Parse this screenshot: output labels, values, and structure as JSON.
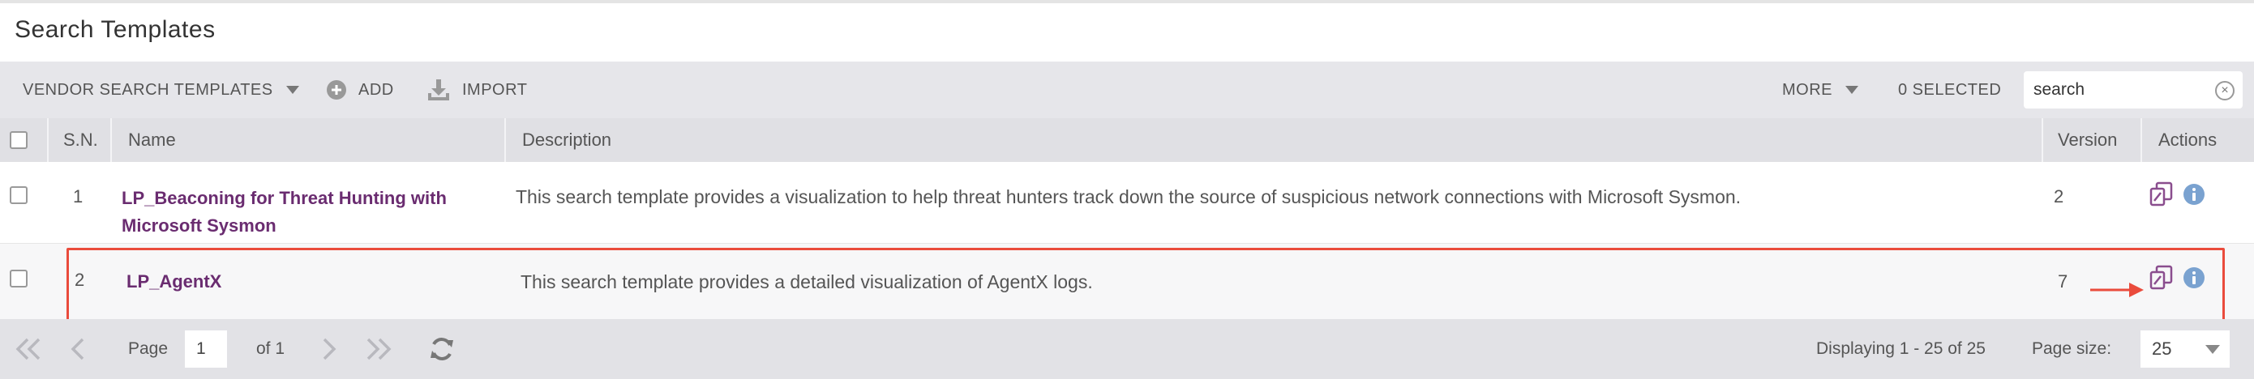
{
  "page": {
    "title": "Search Templates"
  },
  "toolbar": {
    "vendor_label": "VENDOR SEARCH TEMPLATES",
    "add_label": "ADD",
    "import_label": "IMPORT",
    "more_label": "MORE",
    "selected_label": "0 SELECTED",
    "search_value": "search",
    "search_placeholder": "search"
  },
  "table": {
    "columns": [
      "S.N.",
      "Name",
      "Description",
      "Version",
      "Actions"
    ],
    "rows": [
      {
        "sn": "1",
        "name_line1": "LP_Beaconing for Threat Hunting with",
        "name_line2": "Microsoft Sysmon",
        "description": "This search template provides a visualization to help threat hunters track down the source of suspicious network connections with Microsoft Sysmon.",
        "version": "2"
      },
      {
        "sn": "2",
        "name_line1": "LP_AgentX",
        "description": "This search template provides a detailed visualization of AgentX logs.",
        "version": "7"
      }
    ]
  },
  "footer": {
    "page_label": "Page",
    "page_value": "1",
    "of_label": "of 1",
    "displaying": "Displaying 1 - 25 of 25",
    "page_size_label": "Page size:",
    "page_size_value": "25"
  },
  "colors": {
    "accent": "#6a2c70",
    "highlight": "#ea4b3c",
    "icon_blue": "#7aa2d0"
  }
}
